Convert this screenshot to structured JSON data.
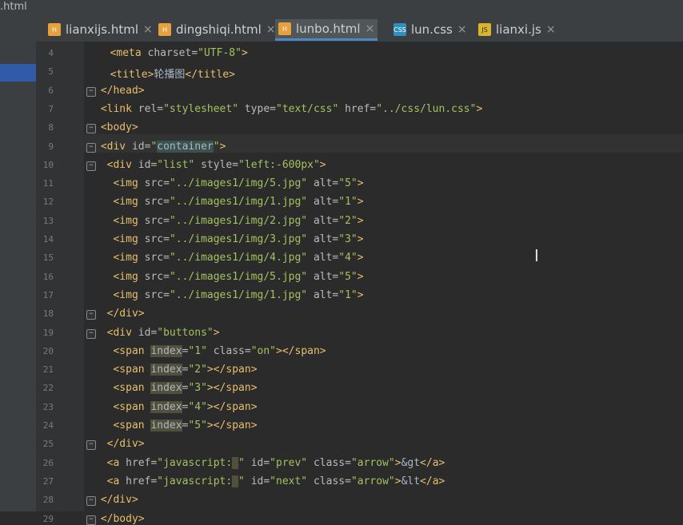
{
  "window": {
    "file_name": ".html"
  },
  "tabs": [
    {
      "label": "lianxijs.html",
      "type": "html",
      "active": false
    },
    {
      "label": "dingshiqi.html",
      "type": "html",
      "active": false
    },
    {
      "label": "lunbo.html",
      "type": "html",
      "active": true
    },
    {
      "label": "lun.css",
      "type": "css",
      "active": false
    },
    {
      "label": "lianxi.js",
      "type": "js",
      "active": false
    }
  ],
  "icons": {
    "close": "close-icon",
    "html_file": "html-file-icon",
    "css_file": "css-file-icon",
    "js_file": "js-file-icon",
    "fold": "fold-marker-icon",
    "text_cursor": "text-cursor-icon"
  },
  "lines": [
    {
      "n": "4",
      "tokens": [
        [
          "t",
          "<meta "
        ],
        [
          "a",
          "charset="
        ],
        [
          "s",
          "\"UTF-8\""
        ],
        [
          "t",
          ">"
        ]
      ]
    },
    {
      "n": "5",
      "tokens": [
        [
          "t",
          "<title>"
        ],
        [
          "p",
          "轮播图"
        ],
        [
          "t",
          "</title>"
        ]
      ]
    },
    {
      "n": "6",
      "tokens": [
        [
          "t",
          "</head>"
        ]
      ]
    },
    {
      "n": "7",
      "tokens": [
        [
          "t",
          "<link "
        ],
        [
          "a",
          "rel="
        ],
        [
          "s",
          "\"stylesheet\" "
        ],
        [
          "a",
          "type="
        ],
        [
          "s",
          "\"text/css\" "
        ],
        [
          "a",
          "href="
        ],
        [
          "s",
          "\"../css/lun.css\""
        ],
        [
          "t",
          ">"
        ]
      ]
    },
    {
      "n": "8",
      "tokens": [
        [
          "t",
          "<body>"
        ]
      ]
    },
    {
      "n": "9",
      "tokens": [
        [
          "t",
          "<div "
        ],
        [
          "a",
          "id="
        ],
        [
          "s",
          "\""
        ],
        [
          "hl",
          "container"
        ],
        [
          "s",
          "\""
        ],
        [
          "t",
          ">"
        ]
      ]
    },
    {
      "n": "10",
      "tokens": [
        [
          "t",
          "<div "
        ],
        [
          "a",
          "id="
        ],
        [
          "s",
          "\"list\" "
        ],
        [
          "a",
          "style="
        ],
        [
          "s",
          "\"left:-600px\""
        ],
        [
          "t",
          ">"
        ]
      ]
    },
    {
      "n": "11",
      "tokens": [
        [
          "t",
          "<img "
        ],
        [
          "a",
          "src="
        ],
        [
          "s",
          "\"../images1/img/5.jpg\" "
        ],
        [
          "a",
          "alt="
        ],
        [
          "s",
          "\"5\""
        ],
        [
          "t",
          ">"
        ]
      ]
    },
    {
      "n": "12",
      "tokens": [
        [
          "t",
          "<img "
        ],
        [
          "a",
          "src="
        ],
        [
          "s",
          "\"../images1/img/1.jpg\" "
        ],
        [
          "a",
          "alt="
        ],
        [
          "s",
          "\"1\""
        ],
        [
          "t",
          ">"
        ]
      ]
    },
    {
      "n": "13",
      "tokens": [
        [
          "t",
          "<img "
        ],
        [
          "a",
          "src="
        ],
        [
          "s",
          "\"../images1/img/2.jpg\" "
        ],
        [
          "a",
          "alt="
        ],
        [
          "s",
          "\"2\""
        ],
        [
          "t",
          ">"
        ]
      ]
    },
    {
      "n": "14",
      "tokens": [
        [
          "t",
          "<img "
        ],
        [
          "a",
          "src="
        ],
        [
          "s",
          "\"../images1/img/3.jpg\" "
        ],
        [
          "a",
          "alt="
        ],
        [
          "s",
          "\"3\""
        ],
        [
          "t",
          ">"
        ]
      ]
    },
    {
      "n": "15",
      "tokens": [
        [
          "t",
          "<img "
        ],
        [
          "a",
          "src="
        ],
        [
          "s",
          "\"../images1/img/4.jpg\" "
        ],
        [
          "a",
          "alt="
        ],
        [
          "s",
          "\"4\""
        ],
        [
          "t",
          ">"
        ]
      ]
    },
    {
      "n": "16",
      "tokens": [
        [
          "t",
          "<img "
        ],
        [
          "a",
          "src="
        ],
        [
          "s",
          "\"../images1/img/5.jpg\" "
        ],
        [
          "a",
          "alt="
        ],
        [
          "s",
          "\"5\""
        ],
        [
          "t",
          ">"
        ]
      ]
    },
    {
      "n": "17",
      "tokens": [
        [
          "t",
          "<img "
        ],
        [
          "a",
          "src="
        ],
        [
          "s",
          "\"../images1/img/1.jpg\" "
        ],
        [
          "a",
          "alt="
        ],
        [
          "s",
          "\"1\""
        ],
        [
          "t",
          ">"
        ]
      ]
    },
    {
      "n": "18",
      "tokens": [
        [
          "t",
          "</div>"
        ]
      ]
    },
    {
      "n": "19",
      "tokens": [
        [
          "t",
          "<div "
        ],
        [
          "a",
          "id="
        ],
        [
          "s",
          "\"buttons\""
        ],
        [
          "t",
          ">"
        ]
      ]
    },
    {
      "n": "20",
      "tokens": [
        [
          "t",
          "<span "
        ],
        [
          "hy",
          "index"
        ],
        [
          "a",
          "="
        ],
        [
          "s",
          "\"1\" "
        ],
        [
          "a",
          "class="
        ],
        [
          "s",
          "\"on\""
        ],
        [
          "t",
          "></span>"
        ]
      ]
    },
    {
      "n": "21",
      "tokens": [
        [
          "t",
          "<span "
        ],
        [
          "hy",
          "index"
        ],
        [
          "a",
          "="
        ],
        [
          "s",
          "\"2\""
        ],
        [
          "t",
          "></span>"
        ]
      ]
    },
    {
      "n": "22",
      "tokens": [
        [
          "t",
          "<span "
        ],
        [
          "hy",
          "index"
        ],
        [
          "a",
          "="
        ],
        [
          "s",
          "\"3\""
        ],
        [
          "t",
          "></span>"
        ]
      ]
    },
    {
      "n": "23",
      "tokens": [
        [
          "t",
          "<span "
        ],
        [
          "hy",
          "index"
        ],
        [
          "a",
          "="
        ],
        [
          "s",
          "\"4\""
        ],
        [
          "t",
          "></span>"
        ]
      ]
    },
    {
      "n": "24",
      "tokens": [
        [
          "t",
          "<span "
        ],
        [
          "hy",
          "index"
        ],
        [
          "a",
          "="
        ],
        [
          "s",
          "\"5\""
        ],
        [
          "t",
          "></span>"
        ]
      ]
    },
    {
      "n": "25",
      "tokens": [
        [
          "t",
          "</div>"
        ]
      ]
    },
    {
      "n": "26",
      "tokens": [
        [
          "t",
          "<a "
        ],
        [
          "a",
          "href="
        ],
        [
          "s",
          "\"javascript:"
        ],
        [
          "hy",
          " "
        ],
        [
          "s",
          "\" "
        ],
        [
          "a",
          "id="
        ],
        [
          "s",
          "\"prev\" "
        ],
        [
          "a",
          "class="
        ],
        [
          "s",
          "\"arrow\""
        ],
        [
          "t",
          ">"
        ],
        [
          "p",
          "&gt"
        ],
        [
          "t",
          "</a>"
        ]
      ]
    },
    {
      "n": "27",
      "tokens": [
        [
          "t",
          "<a "
        ],
        [
          "a",
          "href="
        ],
        [
          "s",
          "\"javascript:"
        ],
        [
          "hy",
          " "
        ],
        [
          "s",
          "\" "
        ],
        [
          "a",
          "id="
        ],
        [
          "s",
          "\"next\" "
        ],
        [
          "a",
          "class="
        ],
        [
          "s",
          "\"arrow\""
        ],
        [
          "t",
          ">"
        ],
        [
          "p",
          "&lt"
        ],
        [
          "t",
          "</a>"
        ]
      ]
    },
    {
      "n": "28",
      "tokens": [
        [
          "t",
          "</div>"
        ]
      ]
    },
    {
      "n": "29",
      "tokens": [
        [
          "t",
          "</body>"
        ]
      ]
    }
  ]
}
